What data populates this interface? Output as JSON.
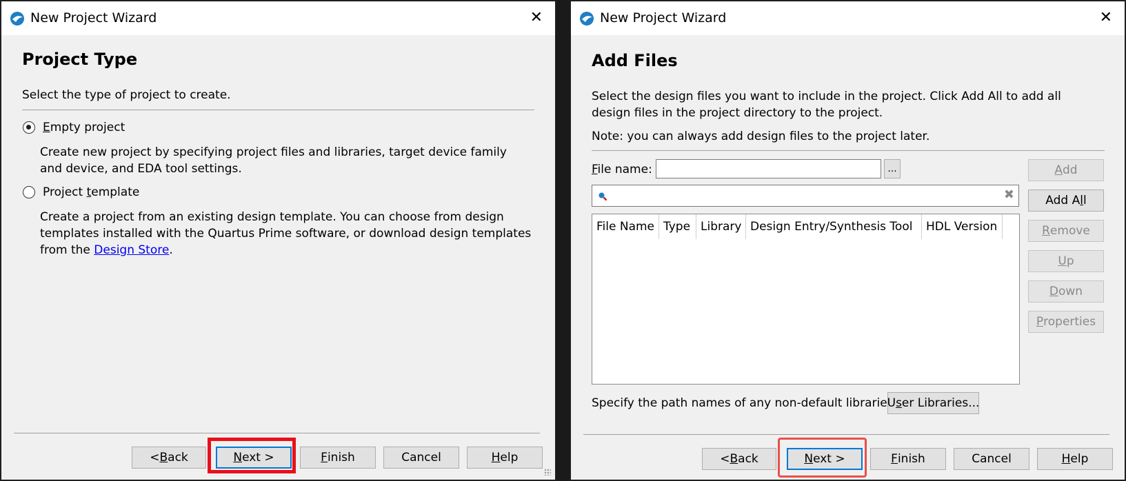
{
  "left_dialog": {
    "title": "New Project Wizard",
    "heading": "Project Type",
    "instruction": "Select the type of project to create.",
    "options": [
      {
        "label_mnemonic": "E",
        "label_rest": "mpty project",
        "checked": true,
        "desc": "Create new project by specifying project files and libraries, target device family and device, and EDA tool settings."
      },
      {
        "label_pre": "Project ",
        "label_mnemonic": "t",
        "label_rest": "emplate",
        "checked": false,
        "desc": "Create a project from an existing design template. You can choose from design templates installed with the Quartus Prime software, or download design templates from the ",
        "desc_link": "Design Store",
        "desc_end": "."
      }
    ],
    "buttons": {
      "back_pre": "< ",
      "back_mn": "B",
      "back_rest": "ack",
      "next_mn": "N",
      "next_rest": "ext >",
      "finish_mn": "F",
      "finish_rest": "inish",
      "cancel": "Cancel",
      "help_mn": "H",
      "help_rest": "elp"
    }
  },
  "right_dialog": {
    "title": "New Project Wizard",
    "heading": "Add Files",
    "instruction": "Select the design files you want to include in the project. Click Add All to add all design files in the project directory to the project.",
    "note": "Note: you can always add design files to the project later.",
    "file_name_label_mn": "F",
    "file_name_label_rest": "ile name:",
    "file_name_value": "",
    "browse_label": "...",
    "search_value": "",
    "columns": [
      "File Name",
      "Type",
      "Library",
      "Design Entry/Synthesis Tool",
      "HDL Version"
    ],
    "side_buttons": [
      {
        "mn": "A",
        "rest": "dd",
        "enabled": false
      },
      {
        "pre": "Add A",
        "mn": "l",
        "rest": "l",
        "enabled": true
      },
      {
        "mn": "R",
        "rest": "emove",
        "enabled": false
      },
      {
        "mn": "U",
        "rest": "p",
        "enabled": false
      },
      {
        "mn": "D",
        "rest": "own",
        "enabled": false
      },
      {
        "mn": "P",
        "rest": "roperties",
        "enabled": false
      }
    ],
    "libraries_text": "Specify the path names of any non-default libraries.",
    "user_libraries_pre": "U",
    "user_libraries_mn": "s",
    "user_libraries_rest": "er Libraries...",
    "buttons": {
      "back_pre": "< ",
      "back_mn": "B",
      "back_rest": "ack",
      "next_mn": "N",
      "next_rest": "ext >",
      "finish_mn": "F",
      "finish_rest": "inish",
      "cancel": "Cancel",
      "help_mn": "H",
      "help_rest": "elp"
    }
  },
  "colors": {
    "highlight_left": "#e8101a",
    "highlight_right": "#e8504a",
    "dialog_bg": "#f0f0f0",
    "link": "#0000ee"
  }
}
